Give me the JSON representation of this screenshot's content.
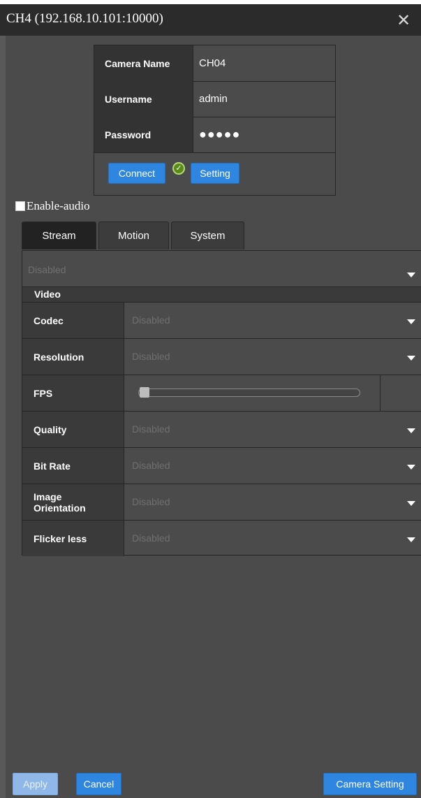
{
  "window": {
    "title": "CH4 (192.168.10.101:10000)",
    "close_icon": "close-icon"
  },
  "credentials": {
    "camera_name_label": "Camera Name",
    "camera_name_value": "CH04",
    "username_label": "Username",
    "username_value": "admin",
    "password_label": "Password",
    "password_value": "●●●●●",
    "connect_label": "Connect",
    "status_icon": "check-circle-icon",
    "setting_label": "Setting"
  },
  "audio": {
    "label": "Enable-audio",
    "checked": false
  },
  "tabs": [
    {
      "label": "Stream",
      "active": true
    },
    {
      "label": "Motion",
      "active": false
    },
    {
      "label": "System",
      "active": false
    }
  ],
  "stream": {
    "selector_value": "Disabled",
    "video_header": "Video",
    "rows": {
      "codec": {
        "label": "Codec",
        "value": "Disabled"
      },
      "resolution": {
        "label": "Resolution",
        "value": "Disabled"
      },
      "fps": {
        "label": "FPS",
        "value_fraction": 0
      },
      "quality": {
        "label": "Quality",
        "value": "Disabled"
      },
      "bitrate": {
        "label": "Bit Rate",
        "value": "Disabled"
      },
      "orientation": {
        "label_line1": "Image",
        "label_line2": "Orientation",
        "value": "Disabled"
      },
      "flicker": {
        "label": "Flicker less",
        "value": "Disabled"
      }
    }
  },
  "footer": {
    "apply_label": "Apply",
    "cancel_label": "Cancel",
    "camera_setting_label": "Camera Setting"
  },
  "colors": {
    "background": "#4b4b4b",
    "titlebar": "#2b2b2b",
    "button_blue": "#2f86e0",
    "status_green": "#5a8a1a"
  }
}
